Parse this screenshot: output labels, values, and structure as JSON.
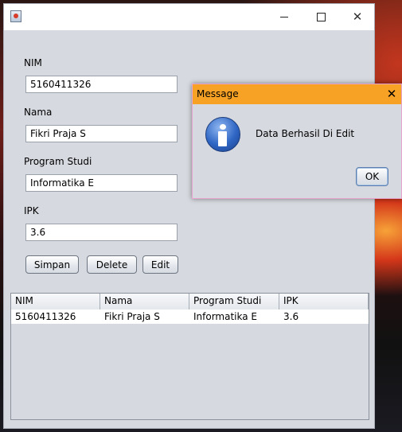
{
  "window": {
    "title": "",
    "controls": {
      "minimize": "minimize-icon",
      "maximize": "maximize-icon",
      "close": "close-icon"
    }
  },
  "form": {
    "nim_label": "NIM",
    "nim_value": "5160411326",
    "nama_label": "Nama",
    "nama_value": "Fikri Praja S",
    "prodi_label": "Program Studi",
    "prodi_value": "Informatika E",
    "ipk_label": "IPK",
    "ipk_value": "3.6"
  },
  "buttons": {
    "simpan": "Simpan",
    "delete": "Delete",
    "edit": "Edit"
  },
  "table": {
    "columns": [
      "NIM",
      "Nama",
      "Program Studi",
      "IPK"
    ],
    "rows": [
      [
        "5160411326",
        "Fikri Praja S",
        "Informatika E",
        "3.6"
      ]
    ]
  },
  "dialog": {
    "title": "Message",
    "message": "Data Berhasil Di Edit",
    "ok_label": "OK",
    "icon": "information-icon",
    "title_color": "#f7a225"
  }
}
